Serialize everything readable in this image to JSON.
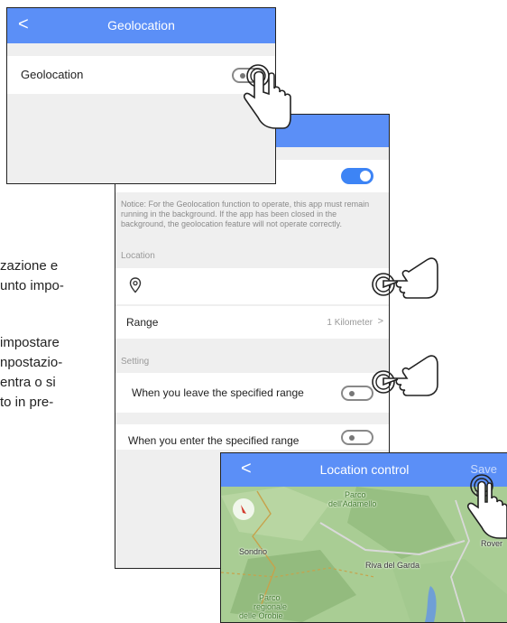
{
  "manual_text": {
    "line1": "zazione e",
    "line2": "unto impo-",
    "line3": "impostare",
    "line4": "npostazio-",
    "line5": "entra o si",
    "line6": "to in pre-"
  },
  "screen1": {
    "back_glyph": "<",
    "title": "Geolocation",
    "row_label": "Geolocation",
    "toggle_state": "off"
  },
  "screen2": {
    "toggle_state": "on",
    "notice": "Notice: For the Geolocation function to operate, this app must remain running in the background. If the app has been closed in the background, the geolocation feature will not operate correctly.",
    "location_header": "Location",
    "range_label": "Range",
    "range_value": "1 Kilometer",
    "setting_header": "Setting",
    "leave_label": "When you leave the specified range",
    "enter_label": "When you enter the specified range"
  },
  "screen3": {
    "back_glyph": "<",
    "title": "Location control",
    "save_label": "Save",
    "map_labels": {
      "parco_adamello_1": "Parco",
      "parco_adamello_2": "dell'Adamello",
      "trento": "Tre",
      "rovereto": "Rover",
      "sondrio": "Sondrio",
      "riva": "Riva del Garda",
      "orobie_1": "Parco",
      "orobie_2": "regionale",
      "orobie_3": "delle Orobie"
    }
  },
  "colors": {
    "accent": "#5b8ff7",
    "toggle_on": "#3d84f5",
    "background": "#efefef"
  }
}
